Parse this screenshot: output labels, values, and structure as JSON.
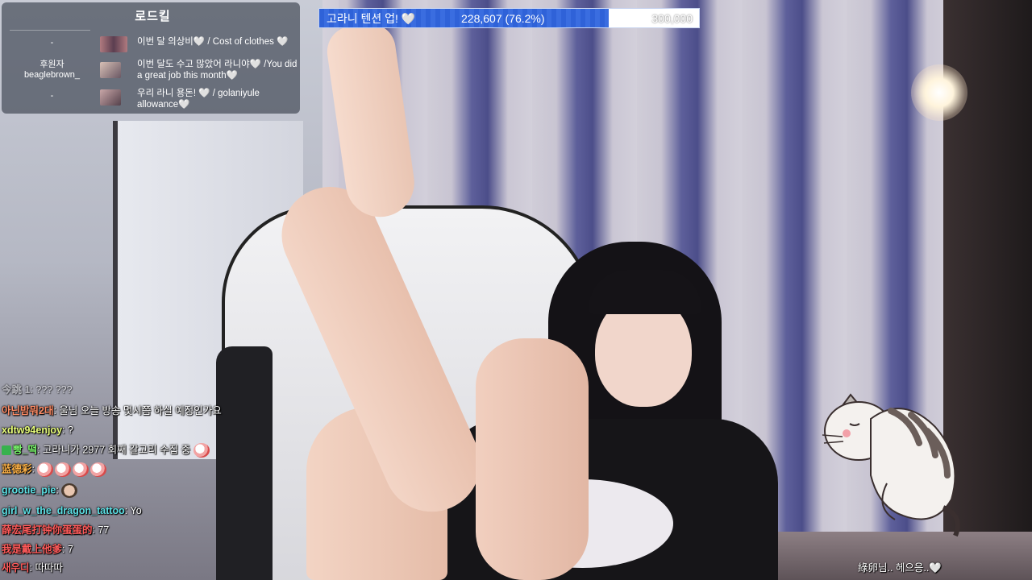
{
  "progress": {
    "label": "고라니 텐션 업! 🤍",
    "count": "228,607 (76.2%)",
    "goal": "300,000",
    "fraction": 0.762,
    "fill_color": "#2f62d8"
  },
  "donor_panel": {
    "title": "로드킬",
    "left": [
      {
        "text": "-"
      },
      {
        "text": "후원자"
      },
      {
        "text": "beaglebrown_"
      },
      {
        "text": "-"
      }
    ],
    "rows": [
      {
        "message": "이번 달 의상비🤍 / Cost of clothes 🤍"
      },
      {
        "message": "이번 달도 수고 많았어 라니야🤍 /You did a great job this month🤍"
      },
      {
        "message": "우리 라니 용돈! 🤍 / golaniyule allowance🤍"
      }
    ]
  },
  "chat": [
    {
      "name": "今跳 1",
      "text": ": ??? ???"
    },
    {
      "name": "아닌밤뭐2대",
      "text": ": 울님 오늘 방송 몇시쯤 하실 예정인가요"
    },
    {
      "name": "xdtw94enjoy",
      "text": ": ?"
    },
    {
      "name": "빵_떡",
      "text": ": 고라니가 2977 회째 갈고리 수집 중"
    },
    {
      "name": "蓝德彩",
      "text": ":"
    },
    {
      "name": "grootie_pie",
      "text": ":"
    },
    {
      "name": "girl_w_the_dragon_tattoo",
      "text": ": Yo"
    },
    {
      "name": "薛宏尾打钟你蛋蛋的",
      "text": ": 77"
    },
    {
      "name": "我是戴上他爹",
      "text": ": 7"
    },
    {
      "name": "새우디",
      "text": ": 따따따"
    }
  ],
  "bottom_right": "綠卵님.. 헤으응..🤍",
  "cat_icon": "cat-sticker-icon",
  "colors": {
    "chat_name_green": "#7CFC6E",
    "chat_name_red": "#FF5A5A",
    "chat_name_orange": "#FFB347",
    "chat_name_teal": "#5CE1E6"
  }
}
